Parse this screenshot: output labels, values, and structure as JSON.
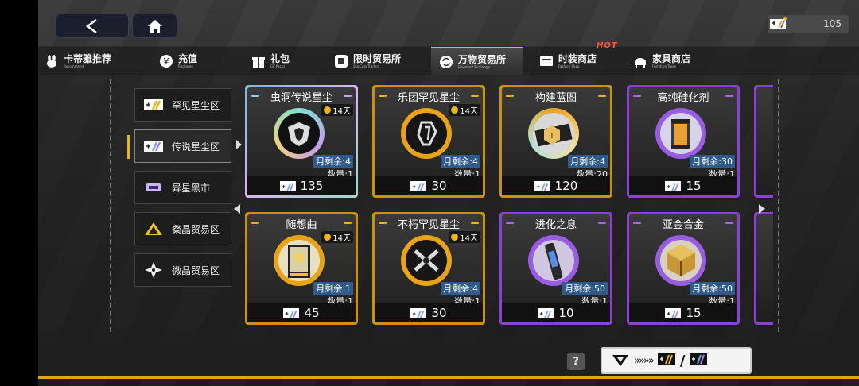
{
  "currency": {
    "amount": "105"
  },
  "tabs": [
    {
      "cn": "卡蒂雅推荐",
      "en": "Recommend",
      "icon": "rabbit-icon"
    },
    {
      "cn": "充值",
      "en": "Recharge",
      "icon": "yen-icon"
    },
    {
      "cn": "礼包",
      "en": "Gif Packs",
      "icon": "gift-icon"
    },
    {
      "cn": "限时贸易所",
      "en": "StarCoin Trading",
      "icon": "starcoin-icon"
    },
    {
      "cn": "万物贸易所",
      "en": "Fragment Exchange",
      "icon": "exchange-icon",
      "active": true
    },
    {
      "cn": "时装商店",
      "en": "Fashion Shop",
      "icon": "fashion-icon"
    },
    {
      "cn": "家具商店",
      "en": "Furniture Trade",
      "icon": "furniture-icon"
    }
  ],
  "hot_label": "HOT",
  "sidebar": [
    {
      "label": "罕见星尘区",
      "icon": "rare-stardust-icon"
    },
    {
      "label": "传说星尘区",
      "icon": "legend-stardust-icon",
      "active": true
    },
    {
      "label": "异星黑市",
      "icon": "blackmarket-icon"
    },
    {
      "label": "粲晶贸易区",
      "icon": "triangle-crystal-icon"
    },
    {
      "label": "微晶贸易区",
      "icon": "star-crystal-icon"
    }
  ],
  "cards": [
    {
      "name": "虫洞传说星尘",
      "time": "14天",
      "monthly": "月剩余:4",
      "qty": "数量:1",
      "price": "135",
      "style": "legend"
    },
    {
      "name": "乐团罕见星尘",
      "time": "14天",
      "monthly": "月剩余:4",
      "qty": "数量:1",
      "price": "30",
      "style": "gold"
    },
    {
      "name": "构建蓝图",
      "time": "",
      "monthly": "月剩余:4",
      "qty": "数量:20",
      "price": "120",
      "style": "gold"
    },
    {
      "name": "高纯硅化剂",
      "time": "",
      "monthly": "月剩余:30",
      "qty": "数量:1",
      "price": "15",
      "style": "purple"
    },
    {
      "name": "随想曲",
      "time": "14天",
      "monthly": "月剩余:1",
      "qty": "数量:1",
      "price": "45",
      "style": "gold"
    },
    {
      "name": "不朽罕见星尘",
      "time": "14天",
      "monthly": "月剩余:4",
      "qty": "数量:1",
      "price": "30",
      "style": "gold"
    },
    {
      "name": "进化之息",
      "time": "",
      "monthly": "月剩余:50",
      "qty": "数量:1",
      "price": "10",
      "style": "purple"
    },
    {
      "name": "亚金合金",
      "time": "",
      "monthly": "月剩余:50",
      "qty": "数量:1",
      "price": "15",
      "style": "purple"
    }
  ],
  "help_label": "?",
  "exchange": {
    "arrows": "»»»»",
    "slash": "/"
  }
}
